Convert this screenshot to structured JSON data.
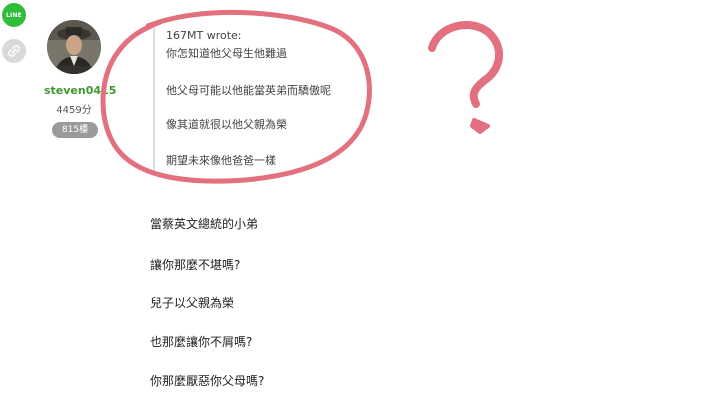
{
  "share": {
    "line_label": "LINE"
  },
  "author": {
    "username": "steven0415",
    "points": "4459分",
    "floor": "815樓"
  },
  "quote": {
    "header": "167MT wrote:",
    "lines": [
      "你怎知道他父母生他難過",
      "他父母可能以他能當英弟而驕傲呢",
      "像其道就很以他父親為榮",
      "期望未來像他爸爸一樣"
    ]
  },
  "post": {
    "lines": [
      "當蔡英文總統的小弟",
      "讓你那麼不堪嗎?",
      "兒子以父親為榮",
      "也那麼讓你不屑嗎?",
      "你那麼厭惡你父母嗎?"
    ]
  },
  "annotation": {
    "color": "#e2707e"
  }
}
